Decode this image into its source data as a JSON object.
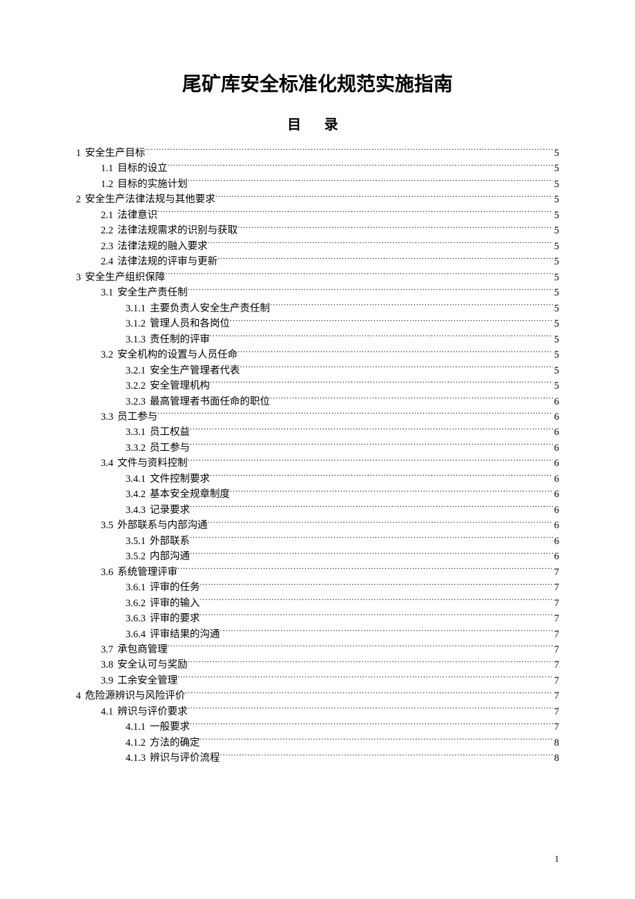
{
  "title": "尾矿库安全标准化规范实施指南",
  "subtitle": "目 录",
  "page_number": "1",
  "toc": [
    {
      "level": 0,
      "num": "1",
      "label": "安全生产目标",
      "page": "5"
    },
    {
      "level": 1,
      "num": "1.1",
      "label": "目标的设立",
      "page": "5"
    },
    {
      "level": 1,
      "num": "1.2",
      "label": "目标的实施计划",
      "page": "5"
    },
    {
      "level": 0,
      "num": "2",
      "label": "安全生产法律法规与其他要求",
      "page": "5"
    },
    {
      "level": 1,
      "num": "2.1",
      "label": "法律意识",
      "page": "5"
    },
    {
      "level": 1,
      "num": "2.2",
      "label": "法律法规需求的识别与获取",
      "page": "5"
    },
    {
      "level": 1,
      "num": "2.3",
      "label": "法律法规的融入要求",
      "page": "5"
    },
    {
      "level": 1,
      "num": "2.4",
      "label": "法律法规的评审与更新",
      "page": "5"
    },
    {
      "level": 0,
      "num": "3",
      "label": "安全生产组织保障",
      "page": "5"
    },
    {
      "level": 1,
      "num": "3.1",
      "label": "安全生产责任制",
      "page": "5"
    },
    {
      "level": 2,
      "num": "3.1.1",
      "label": "主要负责人安全生产责任制",
      "page": "5"
    },
    {
      "level": 2,
      "num": "3.1.2",
      "label": "管理人员和各岗位",
      "page": "5"
    },
    {
      "level": 2,
      "num": "3.1.3",
      "label": "责任制的评审",
      "page": "5"
    },
    {
      "level": 1,
      "num": "3.2",
      "label": "安全机构的设置与人员任命",
      "page": "5"
    },
    {
      "level": 2,
      "num": "3.2.1",
      "label": "安全生产管理者代表",
      "page": "5"
    },
    {
      "level": 2,
      "num": "3.2.2",
      "label": "安全管理机构",
      "page": "5"
    },
    {
      "level": 2,
      "num": "3.2.3",
      "label": "最高管理者书面任命的职位",
      "page": "6"
    },
    {
      "level": 1,
      "num": "3.3",
      "label": "员工参与",
      "page": "6"
    },
    {
      "level": 2,
      "num": "3.3.1",
      "label": "员工权益",
      "page": "6"
    },
    {
      "level": 2,
      "num": "3.3.2",
      "label": "员工参与",
      "page": "6"
    },
    {
      "level": 1,
      "num": "3.4",
      "label": "文件与资料控制",
      "page": "6"
    },
    {
      "level": 2,
      "num": "3.4.1",
      "label": "文件控制要求",
      "page": "6"
    },
    {
      "level": 2,
      "num": "3.4.2",
      "label": "基本安全规章制度",
      "page": "6"
    },
    {
      "level": 2,
      "num": "3.4.3",
      "label": "记录要求",
      "page": "6"
    },
    {
      "level": 1,
      "num": "3.5",
      "label": "外部联系与内部沟通",
      "page": "6"
    },
    {
      "level": 2,
      "num": "3.5.1",
      "label": "外部联系",
      "page": "6"
    },
    {
      "level": 2,
      "num": "3.5.2",
      "label": "内部沟通",
      "page": "6"
    },
    {
      "level": 1,
      "num": "3.6",
      "label": "系统管理评审",
      "page": "7"
    },
    {
      "level": 2,
      "num": "3.6.1",
      "label": "评审的任务",
      "page": "7"
    },
    {
      "level": 2,
      "num": "3.6.2",
      "label": "评审的输入",
      "page": "7"
    },
    {
      "level": 2,
      "num": "3.6.3",
      "label": "评审的要求",
      "page": "7"
    },
    {
      "level": 2,
      "num": "3.6.4",
      "label": "评审结果的沟通",
      "page": "7"
    },
    {
      "level": 1,
      "num": "3.7",
      "label": "承包商管理",
      "page": "7"
    },
    {
      "level": 1,
      "num": "3.8",
      "label": "安全认可与奖励",
      "page": "7"
    },
    {
      "level": 1,
      "num": "3.9",
      "label": "工余安全管理",
      "page": "7"
    },
    {
      "level": 0,
      "num": "4",
      "label": "危险源辨识与风险评价",
      "page": "7"
    },
    {
      "level": 1,
      "num": "4.1",
      "label": "辨识与评价要求",
      "page": "7"
    },
    {
      "level": 2,
      "num": "4.1.1",
      "label": "一般要求",
      "page": "7"
    },
    {
      "level": 2,
      "num": "4.1.2",
      "label": "方法的确定",
      "page": "8"
    },
    {
      "level": 2,
      "num": "4.1.3",
      "label": "辨识与评价流程",
      "page": "8"
    }
  ]
}
